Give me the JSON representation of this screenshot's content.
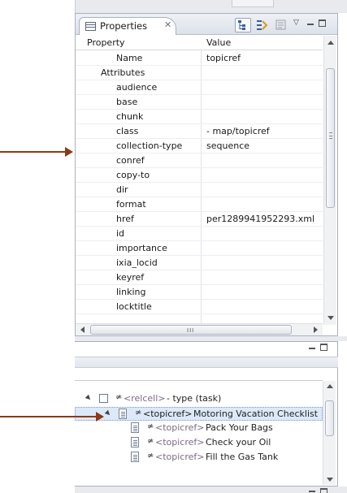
{
  "properties_view": {
    "tab_title": "Properties",
    "tab_close_glyph": "✕",
    "columns": {
      "property": "Property",
      "value": "Value"
    },
    "rows": [
      {
        "name": "Name",
        "value": "topicref",
        "indent": 2
      },
      {
        "name": "Attributes",
        "value": "",
        "indent": 1
      },
      {
        "name": "audience",
        "value": "",
        "indent": 2
      },
      {
        "name": "base",
        "value": "",
        "indent": 2
      },
      {
        "name": "chunk",
        "value": "",
        "indent": 2
      },
      {
        "name": "class",
        "value": "- map/topicref",
        "indent": 2
      },
      {
        "name": "collection-type",
        "value": "sequence",
        "indent": 2
      },
      {
        "name": "conref",
        "value": "",
        "indent": 2
      },
      {
        "name": "copy-to",
        "value": "",
        "indent": 2
      },
      {
        "name": "dir",
        "value": "",
        "indent": 2
      },
      {
        "name": "format",
        "value": "",
        "indent": 2
      },
      {
        "name": "href",
        "value": "per1289941952293.xml",
        "indent": 2
      },
      {
        "name": "id",
        "value": "",
        "indent": 2
      },
      {
        "name": "importance",
        "value": "",
        "indent": 2
      },
      {
        "name": "ixia_locid",
        "value": "",
        "indent": 2
      },
      {
        "name": "keyref",
        "value": "",
        "indent": 2
      },
      {
        "name": "linking",
        "value": "",
        "indent": 2
      },
      {
        "name": "locktitle",
        "value": "",
        "indent": 2
      }
    ],
    "toolbar_icons": [
      "tree-view-icon",
      "filter-icon",
      "advanced-icon",
      "view-menu-icon",
      "minimize-icon",
      "maximize-icon"
    ],
    "hscroll_grip": "III"
  },
  "outline_view": {
    "rows": [
      {
        "tag": "<relcell>",
        "label": " - type (task)",
        "selected": false,
        "kind": "checkbox",
        "expanded": true
      },
      {
        "tag": "<topicref>",
        "label": " Motoring Vacation Checklist",
        "selected": true,
        "kind": "doc",
        "expanded": true
      },
      {
        "tag": "<topicref>",
        "label": " Pack Your Bags",
        "selected": false,
        "kind": "doc",
        "expanded": false
      },
      {
        "tag": "<topicref>",
        "label": " Check your Oil",
        "selected": false,
        "kind": "doc",
        "expanded": false
      },
      {
        "tag": "<topicref>",
        "label": " Fill the Gas Tank",
        "selected": false,
        "kind": "doc",
        "expanded": false
      }
    ],
    "link_symbol": "≄"
  },
  "annotations": {
    "arrow_color": "#8b3a1a"
  },
  "colors": {
    "selection_bg": "#dce9f8",
    "tag_color": "#7d6a86",
    "header_bg": "#dde2ea"
  }
}
